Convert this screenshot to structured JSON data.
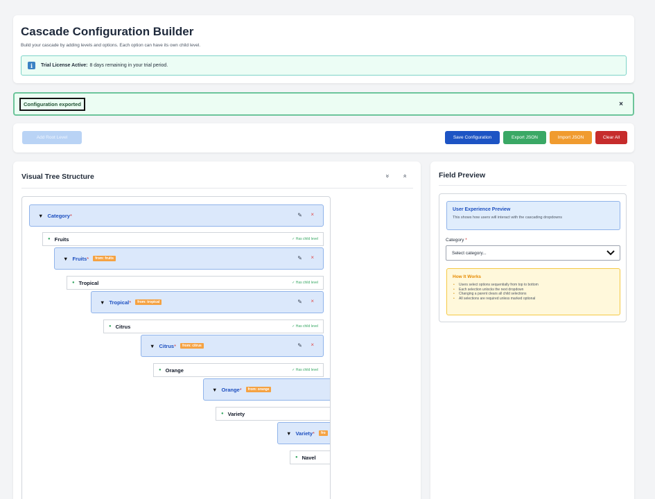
{
  "header": {
    "title": "Cascade Configuration Builder",
    "subtitle": "Build your cascade by adding levels and options. Each option can have its own child level.",
    "license_label": "Trial License Active:",
    "license_text": "8 days remaining in your trial period.",
    "license_icon": "i"
  },
  "toast": {
    "message": "Configuration exported",
    "close": "×"
  },
  "toolbar": {
    "add_root": "Add Root Level",
    "save": "Save Configuration",
    "export": "Export JSON",
    "import": "Import JSON",
    "clear": "Clear All"
  },
  "tree": {
    "title": "Visual Tree Structure",
    "collapse_all": "»",
    "expand_all": "»",
    "has_child": "✓ Has child level",
    "required_mark": "*",
    "edit_icon": "✎",
    "delete_icon": "×",
    "levels": [
      {
        "name": "Category",
        "from": ""
      },
      {
        "name": "Fruits",
        "from": "from: fruits"
      },
      {
        "name": "Tropical",
        "from": "from: tropical"
      },
      {
        "name": "Citrus",
        "from": "from: citrus"
      },
      {
        "name": "Orange",
        "from": "from: orange"
      },
      {
        "name": "Variety",
        "from": "fro"
      }
    ],
    "options": [
      {
        "name": "Fruits",
        "has_child": true
      },
      {
        "name": "Tropical",
        "has_child": true
      },
      {
        "name": "Citrus",
        "has_child": true
      },
      {
        "name": "Orange",
        "has_child": true
      },
      {
        "name": "Variety",
        "has_child": false
      },
      {
        "name": "Navel",
        "has_child": false
      }
    ]
  },
  "preview": {
    "title": "Field Preview",
    "ux_title": "User Experience Preview",
    "ux_desc": "This shows how users will interact with the cascading dropdowns",
    "category_label": "Category",
    "required_mark": "*",
    "select_placeholder": "Select category...",
    "how_title": "How It Works",
    "how_items": [
      "Users select options sequentially from top to bottom",
      "Each selection unlocks the next dropdown",
      "Changing a parent clears all child selections",
      "All selections are required unless marked optional"
    ]
  },
  "colors": {
    "primary": "#1d54c4",
    "success": "#3aa865",
    "warning": "#f09b2f",
    "danger": "#c62c2c"
  }
}
